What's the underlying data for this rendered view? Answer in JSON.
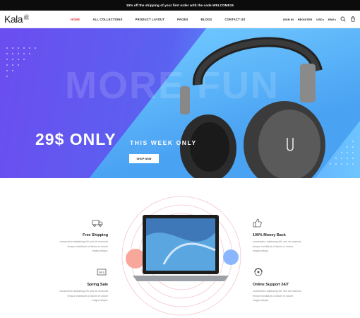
{
  "promo": "15% off the shipping of your first order with the code WELCOME15",
  "logo": {
    "text": "Kala",
    "mark": "ﷺ"
  },
  "nav": [
    "HOME",
    "ALL COLLECTIONS",
    "PRODUCT LAYOUT",
    "PAGES",
    "BLOGS",
    "CONTACT US"
  ],
  "header_right": {
    "signin": "SIGN IN",
    "register": "REGISTER",
    "currency": "USD",
    "language": "ENG"
  },
  "hero": {
    "bg_word": "MORE FUN",
    "price": "29$ ONLY",
    "subtitle": "THIS WEEK ONLY",
    "cta": "SHOP NOW"
  },
  "features": [
    {
      "title": "Free Shipping",
      "text": [
        "consectetur adipiscing elit, sed do eiusmod",
        "tempor incididunt ut labore et dolore",
        "magna aliqua."
      ],
      "icon": "truck-icon"
    },
    {
      "title": "Spring Sale",
      "text": [
        "consectetur adipiscing elit, sed do eiusmod",
        "tempor incididunt ut labore et dolore",
        "magna aliqua."
      ],
      "icon": "sale-tag-icon"
    },
    {
      "title": "100% Money Back",
      "text": [
        "consectetur adipiscing elit, sed do eiusmod",
        "tempor incididunt ut labore et dolore",
        "magna aliqua."
      ],
      "icon": "thumbs-up-icon"
    },
    {
      "title": "Online Support 24/7",
      "text": [
        "consectetur adipiscing elit, sed do eiusmod",
        "tempor incididunt ut labore et dolore",
        "magna aliqua."
      ],
      "icon": "support-icon"
    }
  ],
  "colors": {
    "accent": "#e0343a",
    "hero_purple": "#6b4df0",
    "hero_blue": "#5aa0ff"
  }
}
